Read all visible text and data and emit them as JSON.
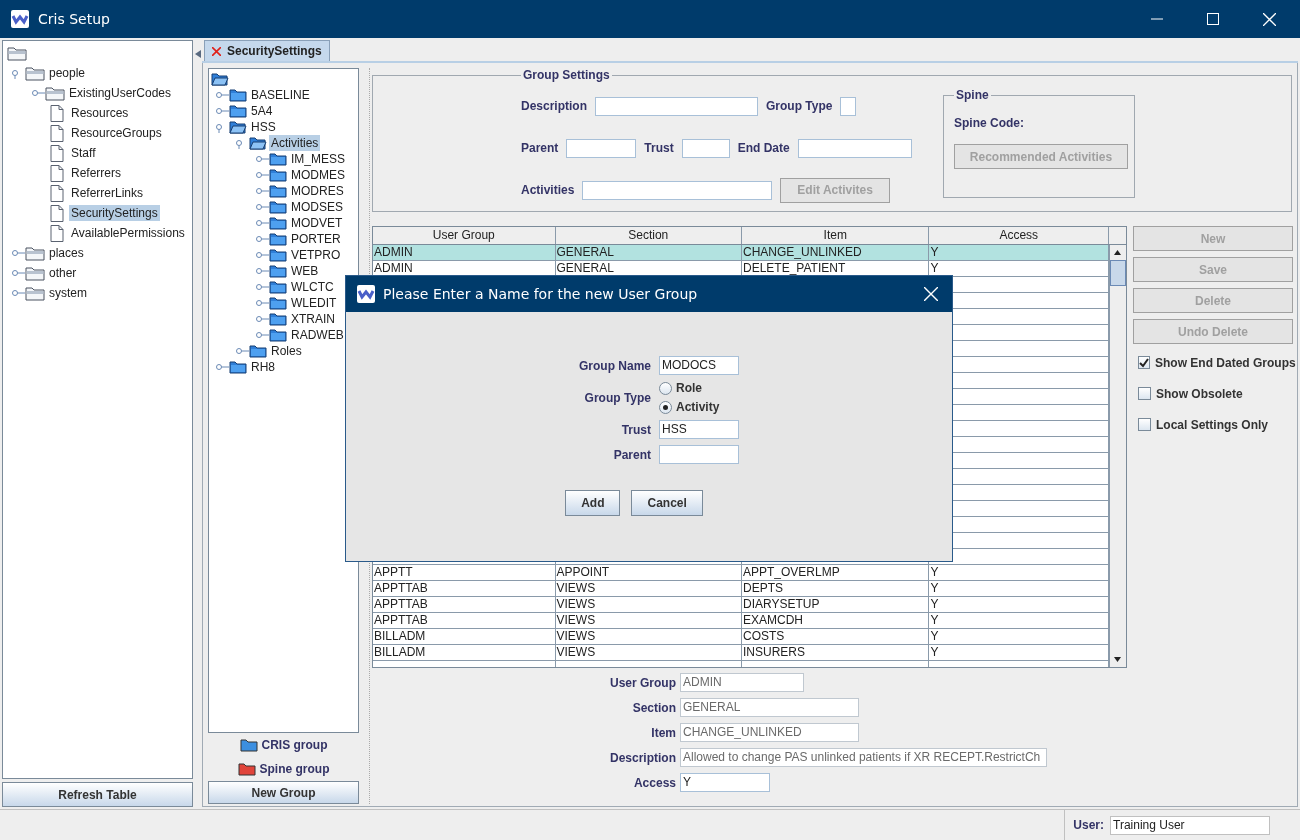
{
  "window": {
    "title": "Cris Setup"
  },
  "nav_tree": [
    {
      "kind": "folder",
      "children": [
        {
          "label": "people",
          "kind": "folder",
          "expanded": true,
          "selected": false,
          "children": [
            {
              "label": "ExistingUserCodes",
              "kind": "folder",
              "expanded": false,
              "selected": false
            },
            {
              "label": "Resources",
              "kind": "doc",
              "selected": false
            },
            {
              "label": "ResourceGroups",
              "kind": "doc",
              "selected": false
            },
            {
              "label": "Staff",
              "kind": "doc",
              "selected": false
            },
            {
              "label": "Referrers",
              "kind": "doc",
              "selected": false
            },
            {
              "label": "ReferrerLinks",
              "kind": "doc",
              "selected": false
            },
            {
              "label": "SecuritySettings",
              "kind": "doc",
              "selected": true
            },
            {
              "label": "AvailablePermissions",
              "kind": "doc",
              "selected": false
            }
          ]
        },
        {
          "label": "places",
          "kind": "folder",
          "expanded": false,
          "selected": false
        },
        {
          "label": "other",
          "kind": "folder",
          "expanded": false,
          "selected": false
        },
        {
          "label": "system",
          "kind": "folder",
          "expanded": false,
          "selected": false
        }
      ]
    }
  ],
  "refresh_button": "Refresh Table",
  "tabs": [
    {
      "label": "SecuritySettings",
      "selected": true
    }
  ],
  "group_tree": [
    {
      "kind": "folder",
      "children": [
        {
          "label": "BASELINE",
          "kind": "folder",
          "expanded": false,
          "selected": false
        },
        {
          "label": "5A4",
          "kind": "folder",
          "expanded": false,
          "selected": false
        },
        {
          "label": "HSS",
          "kind": "folder",
          "expanded": true,
          "selected": false,
          "children": [
            {
              "label": "Activities",
              "kind": "folder",
              "expanded": true,
              "selected": true,
              "children": [
                {
                  "label": "IM_MESS",
                  "kind": "folder",
                  "expanded": false,
                  "selected": false
                },
                {
                  "label": "MODMES",
                  "kind": "folder",
                  "expanded": false,
                  "selected": false
                },
                {
                  "label": "MODRES",
                  "kind": "folder",
                  "expanded": false,
                  "selected": false
                },
                {
                  "label": "MODSES",
                  "kind": "folder",
                  "expanded": false,
                  "selected": false
                },
                {
                  "label": "MODVET",
                  "kind": "folder",
                  "expanded": false,
                  "selected": false
                },
                {
                  "label": "PORTER",
                  "kind": "folder",
                  "expanded": false,
                  "selected": false
                },
                {
                  "label": "VETPRO",
                  "kind": "folder",
                  "expanded": false,
                  "selected": false
                },
                {
                  "label": "WEB",
                  "kind": "folder",
                  "expanded": false,
                  "selected": false
                },
                {
                  "label": "WLCTC",
                  "kind": "folder",
                  "expanded": false,
                  "selected": false
                },
                {
                  "label": "WLEDIT",
                  "kind": "folder",
                  "expanded": false,
                  "selected": false
                },
                {
                  "label": "XTRAIN",
                  "kind": "folder",
                  "expanded": false,
                  "selected": false
                },
                {
                  "label": "RADWEB",
                  "kind": "folder",
                  "expanded": false,
                  "selected": false
                }
              ]
            },
            {
              "label": "Roles",
              "kind": "folder",
              "expanded": false,
              "selected": false
            }
          ]
        },
        {
          "label": "RH8",
          "kind": "folder",
          "expanded": false,
          "selected": false
        }
      ]
    }
  ],
  "legend": [
    {
      "label": "CRIS group",
      "color": "#3c8fe0"
    },
    {
      "label": "Spine group",
      "color": "#e0443a"
    }
  ],
  "new_group_button": "New Group",
  "group_settings": {
    "title": "Group Settings",
    "rows": [
      [
        {
          "label": "Description"
        },
        {
          "label": "Group Type"
        }
      ],
      [
        {
          "label": "Parent"
        },
        {
          "label": "Trust"
        },
        {
          "label": "End Date"
        }
      ],
      [
        {
          "label": "Activities"
        }
      ]
    ],
    "edit_button": {
      "label": "Edit Activites",
      "disabled": true
    },
    "spine": {
      "title": "Spine",
      "code_label": "Spine Code:",
      "button": {
        "label": "Recommended Activities",
        "disabled": true
      }
    }
  },
  "table": {
    "columns": [
      "User Group",
      "Section",
      "Item",
      "Access"
    ],
    "rows": [
      {
        "cells": [
          "ADMIN",
          "GENERAL",
          "CHANGE_UNLINKED",
          "Y"
        ],
        "selected": true
      },
      {
        "cells": [
          "ADMIN",
          "GENERAL",
          "DELETE_PATIENT",
          "Y"
        ],
        "selected": false
      }
    ],
    "rows_after": [
      {
        "cells": [
          "APPTT",
          "APPOINT",
          "APPT_OVERLMP",
          "Y"
        ],
        "selected": false
      },
      {
        "cells": [
          "APPTTAB",
          "VIEWS",
          "DEPTS",
          "Y"
        ],
        "selected": false
      },
      {
        "cells": [
          "APPTTAB",
          "VIEWS",
          "DIARYSETUP",
          "Y"
        ],
        "selected": false
      },
      {
        "cells": [
          "APPTTAB",
          "VIEWS",
          "EXAMCDH",
          "Y"
        ],
        "selected": false
      },
      {
        "cells": [
          "BILLADM",
          "VIEWS",
          "COSTS",
          "Y"
        ],
        "selected": false
      },
      {
        "cells": [
          "BILLADM",
          "VIEWS",
          "INSURERS",
          "Y"
        ],
        "selected": false
      }
    ]
  },
  "actions": [
    {
      "label": "New",
      "disabled": true
    },
    {
      "label": "Save",
      "disabled": true
    },
    {
      "label": "Delete",
      "disabled": true
    },
    {
      "label": "Undo Delete",
      "disabled": true
    }
  ],
  "options": [
    {
      "label": "Show End Dated Groups",
      "checked": true
    },
    {
      "label": "Show Obsolete",
      "checked": false
    },
    {
      "label": "Local Settings Only",
      "checked": false
    }
  ],
  "details": [
    {
      "label": "User Group",
      "value": "ADMIN",
      "disabled": true
    },
    {
      "label": "Section",
      "value": "GENERAL",
      "disabled": true
    },
    {
      "label": "Item",
      "value": "CHANGE_UNLINKED",
      "disabled": true
    },
    {
      "label": "Description",
      "value": "Allowed to change PAS unlinked patients if XR RECEPT.RestrictCh",
      "disabled": true
    },
    {
      "label": "Access",
      "value": "Y",
      "disabled": false
    }
  ],
  "status_bar": {
    "user_label": "User:",
    "user_value": "Training User"
  },
  "dialog": {
    "title": "Please Enter a Name for the new User Group",
    "group_name": {
      "label": "Group Name",
      "value": "MODOCS"
    },
    "group_type": {
      "label": "Group Type",
      "options": [
        {
          "label": "Role",
          "selected": false
        },
        {
          "label": "Activity",
          "selected": true
        }
      ]
    },
    "trust": {
      "label": "Trust",
      "value": "HSS"
    },
    "parent": {
      "label": "Parent"
    },
    "buttons": [
      "Add",
      "Cancel"
    ]
  }
}
